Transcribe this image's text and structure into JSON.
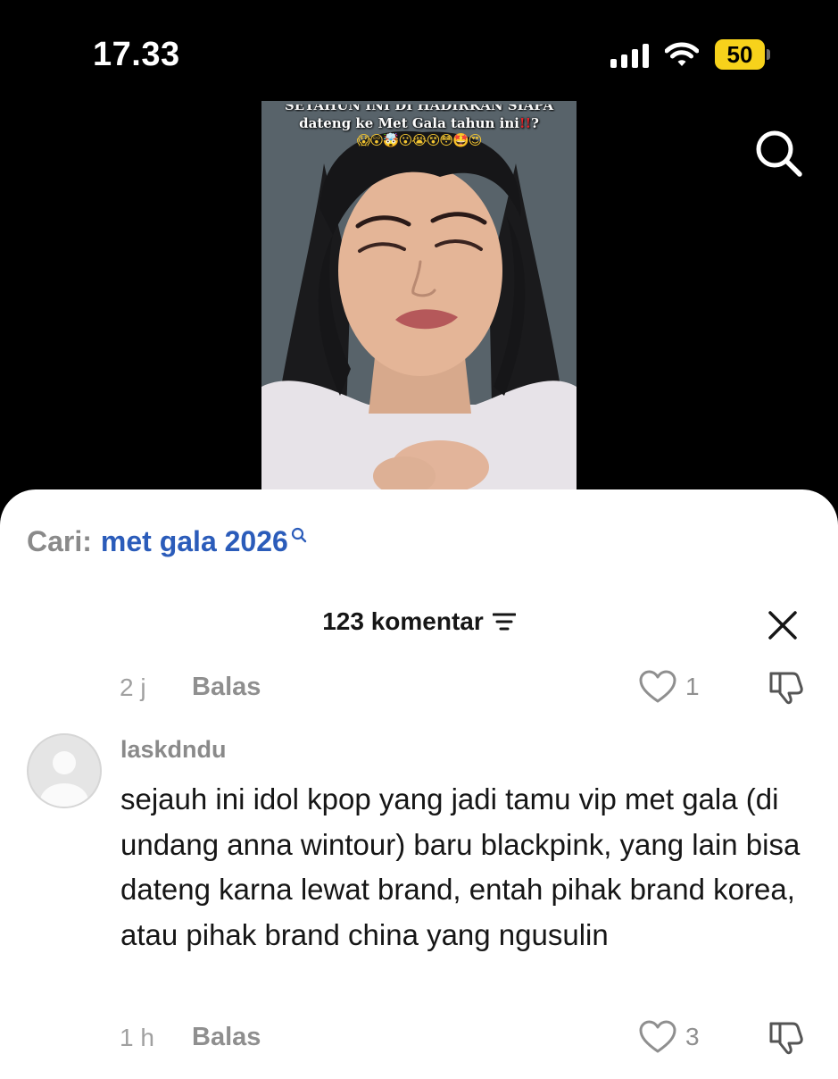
{
  "status_bar": {
    "time": "17.33",
    "battery": "50"
  },
  "video": {
    "caption_line1": "SETAHUN INI DI HADIRKAN SIAPA",
    "caption_line2": "dateng ke Met Gala tahun ini",
    "caption_exclaim": "!!",
    "caption_question": "?",
    "emojis": "😱😲🤯😮😭😵😳🤩😍"
  },
  "search": {
    "prefix": "Cari:",
    "term": "met gala 2026"
  },
  "comments_header": {
    "title": "123 komentar"
  },
  "previous_comment_meta": {
    "time": "2 j",
    "reply": "Balas",
    "likes": "1"
  },
  "comment": {
    "username": "laskdndu",
    "text": "sejauh ini idol kpop yang jadi tamu vip met gala (di undang anna wintour) baru blackpink, yang lain bisa dateng karna lewat brand, entah pihak brand korea, atau pihak brand china yang ngusulin",
    "time": "1 h",
    "reply": "Balas",
    "likes": "3"
  },
  "colors": {
    "accent_link": "#2b5cba",
    "battery": "#f7d21b",
    "muted_text": "#8f8f8f"
  },
  "icons": {
    "search": "search-icon",
    "close": "close-icon",
    "sort": "sort-icon",
    "like": "heart-icon",
    "dislike": "thumbs-down-icon",
    "avatar": "default-avatar-icon"
  }
}
